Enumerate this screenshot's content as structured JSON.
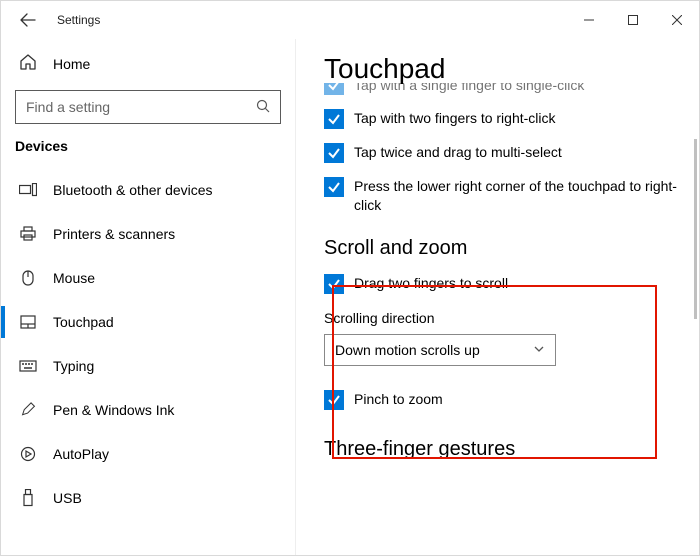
{
  "window": {
    "title": "Settings"
  },
  "sidebar": {
    "home": "Home",
    "search_placeholder": "Find a setting",
    "category": "Devices",
    "items": [
      {
        "label": "Bluetooth & other devices",
        "active": false
      },
      {
        "label": "Printers & scanners",
        "active": false
      },
      {
        "label": "Mouse",
        "active": false
      },
      {
        "label": "Touchpad",
        "active": true
      },
      {
        "label": "Typing",
        "active": false
      },
      {
        "label": "Pen & Windows Ink",
        "active": false
      },
      {
        "label": "AutoPlay",
        "active": false
      },
      {
        "label": "USB",
        "active": false
      }
    ]
  },
  "content": {
    "title": "Touchpad",
    "clipped_partial": "Tap with a single finger to single-click",
    "checks": [
      {
        "label": "Tap with two fingers to right-click",
        "checked": true
      },
      {
        "label": "Tap twice and drag to multi-select",
        "checked": true
      },
      {
        "label": "Press the lower right corner of the touchpad to right-click",
        "checked": true
      }
    ],
    "scroll_zoom_heading": "Scroll and zoom",
    "scroll_zoom_check": {
      "label": "Drag two fingers to scroll",
      "checked": true
    },
    "scroll_direction_label": "Scrolling direction",
    "scroll_direction_value": "Down motion scrolls up",
    "pinch_check": {
      "label": "Pinch to zoom",
      "checked": true
    },
    "three_finger_heading": "Three-finger gestures"
  }
}
